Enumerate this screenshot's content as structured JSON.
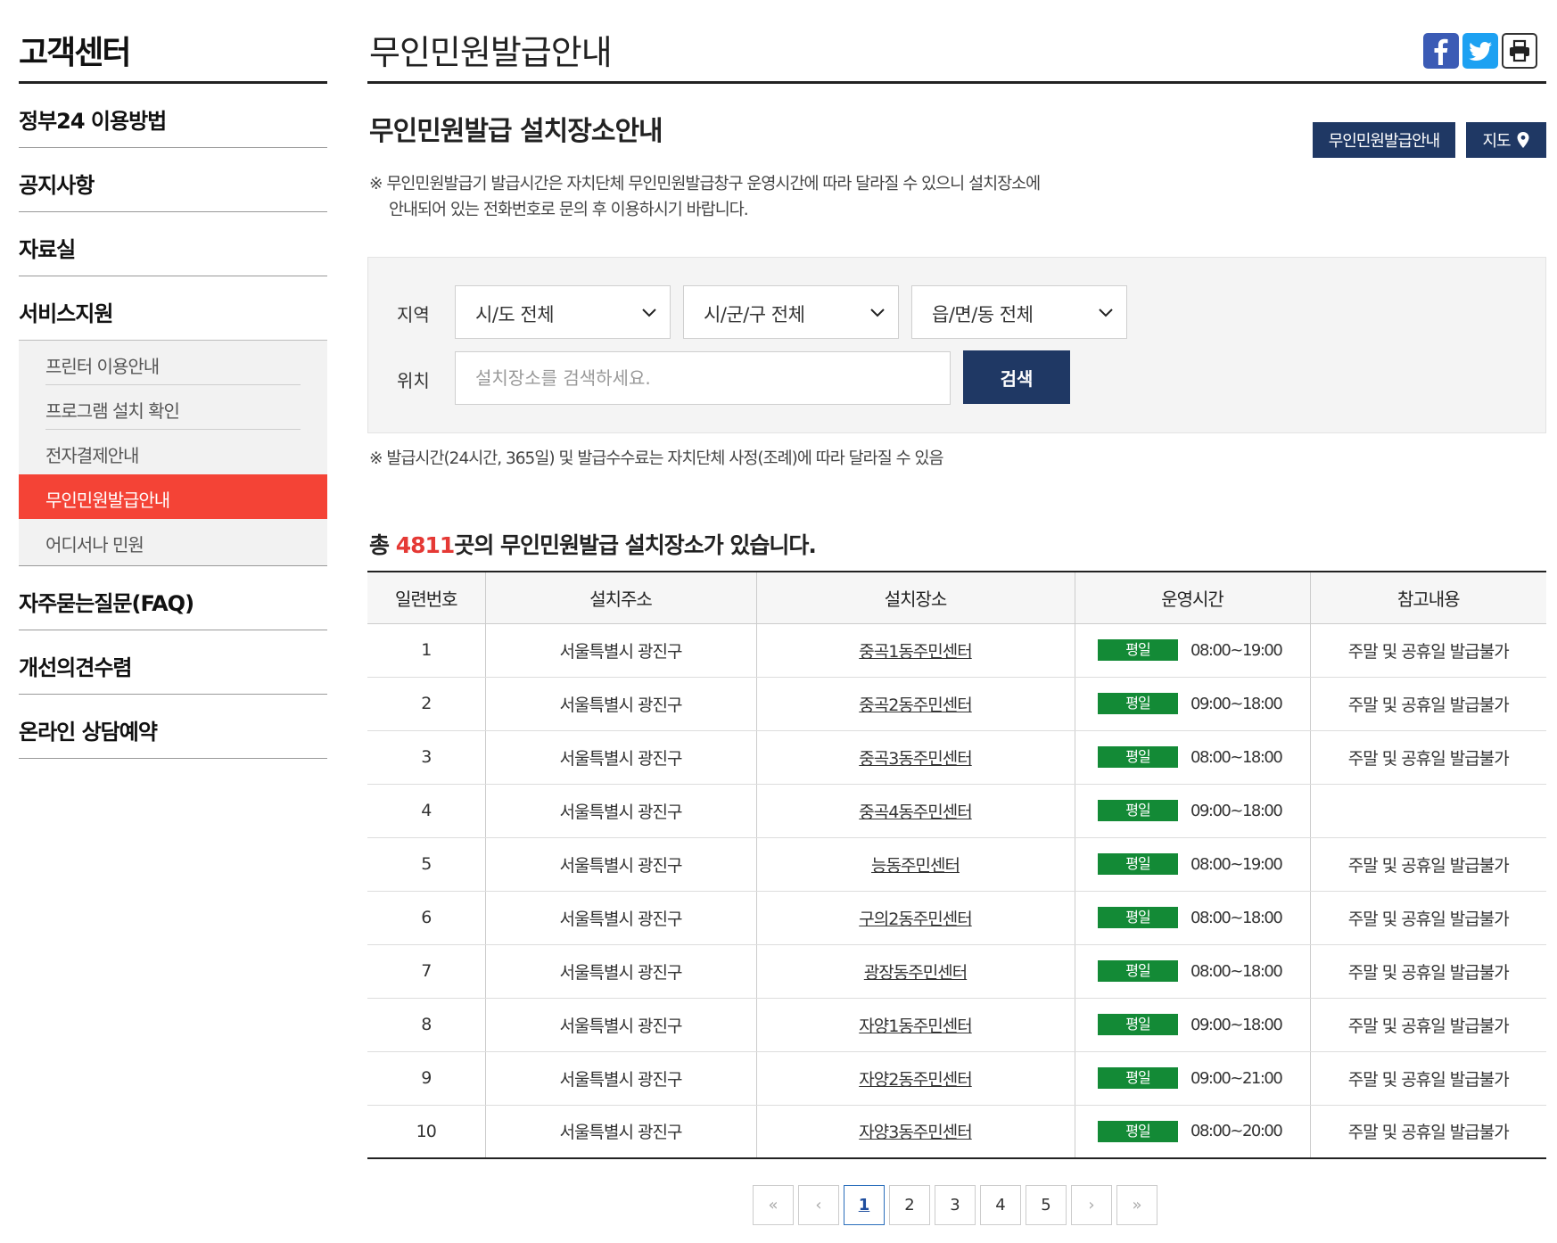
{
  "sidebar": {
    "title": "고객센터",
    "items": [
      {
        "label": "정부24 이용방법"
      },
      {
        "label": "공지사항"
      },
      {
        "label": "자료실"
      },
      {
        "label": "서비스지원"
      },
      {
        "label": "자주묻는질문(FAQ)"
      },
      {
        "label": "개선의견수렴"
      },
      {
        "label": "온라인 상담예약"
      }
    ],
    "sub_items": [
      {
        "label": "프린터 이용안내"
      },
      {
        "label": "프로그램 설치 확인"
      },
      {
        "label": "전자결제안내"
      },
      {
        "label": "무인민원발급안내",
        "active": true
      },
      {
        "label": "어디서나 민원"
      }
    ]
  },
  "page": {
    "title": "무인민원발급안내",
    "share_icons": [
      "facebook-icon",
      "twitter-icon",
      "print-icon"
    ]
  },
  "section": {
    "title": "무인민원발급 설치장소안내",
    "guide_button": "무인민원발급안내",
    "map_button": "지도",
    "notice_line1": "※ 무인민원발급기 발급시간은 자치단체 무인민원발급창구 운영시간에 따라 달라질 수 있으니 설치장소에",
    "notice_line2": "안내되어 있는 전화번호로 문의 후 이용하시기 바랍니다."
  },
  "search": {
    "region_label": "지역",
    "location_label": "위치",
    "sido_selected": "시/도 전체",
    "sigungu_selected": "시/군/구 전체",
    "dong_selected": "읍/면/동 전체",
    "placeholder": "설치장소를 검색하세요.",
    "button": "검색",
    "note": "※ 발급시간(24시간, 365일) 및 발급수수료는 자치단체 사정(조례)에 따라 달라질 수 있음"
  },
  "summary": {
    "prefix": "총 ",
    "count": "4811",
    "suffix": "곳의 무인민원발급 설치장소가 있습니다."
  },
  "table": {
    "headers": [
      "일련번호",
      "설치주소",
      "설치장소",
      "운영시간",
      "참고내용"
    ],
    "rows": [
      {
        "no": "1",
        "address": "서울특별시 광진구",
        "place": "중곡1동주민센터",
        "day": "평일",
        "hours": "08:00~19:00",
        "note": "주말 및 공휴일 발급불가"
      },
      {
        "no": "2",
        "address": "서울특별시 광진구",
        "place": "중곡2동주민센터",
        "day": "평일",
        "hours": "09:00~18:00",
        "note": "주말 및 공휴일 발급불가"
      },
      {
        "no": "3",
        "address": "서울특별시 광진구",
        "place": "중곡3동주민센터",
        "day": "평일",
        "hours": "08:00~18:00",
        "note": "주말 및 공휴일 발급불가"
      },
      {
        "no": "4",
        "address": "서울특별시 광진구",
        "place": "중곡4동주민센터",
        "day": "평일",
        "hours": "09:00~18:00",
        "note": ""
      },
      {
        "no": "5",
        "address": "서울특별시 광진구",
        "place": "능동주민센터",
        "day": "평일",
        "hours": "08:00~19:00",
        "note": "주말 및 공휴일 발급불가"
      },
      {
        "no": "6",
        "address": "서울특별시 광진구",
        "place": "구의2동주민센터",
        "day": "평일",
        "hours": "08:00~18:00",
        "note": "주말 및 공휴일 발급불가"
      },
      {
        "no": "7",
        "address": "서울특별시 광진구",
        "place": "광장동주민센터",
        "day": "평일",
        "hours": "08:00~18:00",
        "note": "주말 및 공휴일 발급불가"
      },
      {
        "no": "8",
        "address": "서울특별시 광진구",
        "place": "자양1동주민센터",
        "day": "평일",
        "hours": "09:00~18:00",
        "note": "주말 및 공휴일 발급불가"
      },
      {
        "no": "9",
        "address": "서울특별시 광진구",
        "place": "자양2동주민센터",
        "day": "평일",
        "hours": "09:00~21:00",
        "note": "주말 및 공휴일 발급불가"
      },
      {
        "no": "10",
        "address": "서울특별시 광진구",
        "place": "자양3동주민센터",
        "day": "평일",
        "hours": "08:00~20:00",
        "note": "주말 및 공휴일 발급불가"
      }
    ]
  },
  "pagination": {
    "first": "«",
    "prev": "‹",
    "pages": [
      "1",
      "2",
      "3",
      "4",
      "5"
    ],
    "current": "1",
    "next": "›",
    "last": "»"
  },
  "colors": {
    "accent_red": "#f44336",
    "navy": "#1f3864",
    "badge_green": "#138a36",
    "count_red": "#e53935"
  }
}
